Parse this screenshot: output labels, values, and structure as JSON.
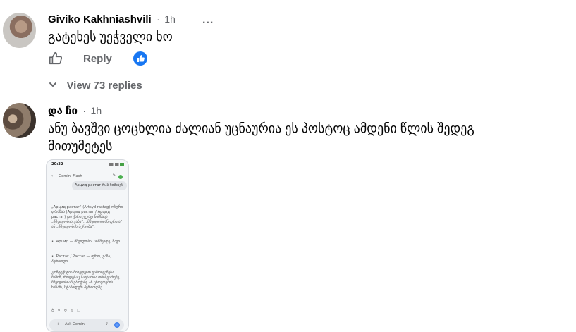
{
  "comment1": {
    "author": "Giviko Kakhniashvili",
    "separator": "·",
    "time": "1h",
    "more": "...",
    "text": "გატეხეს უეჭველი ხო",
    "reply_label": "Reply",
    "like_icon": "thumbs-up-outline-icon",
    "reaction_icon": "like-reaction-icon",
    "view_replies": "View 73 replies",
    "reaction_color": "#1877f2"
  },
  "comment2": {
    "author": "და ჩი",
    "separator": "·",
    "time": "1h",
    "text_line1": "ანუ ბავშვი ცოცხლია ძალიან უცნაურია ეს პოსტოც ამდენი წლის შედეგ",
    "text_line2": "მითუმეტეს"
  },
  "screenshot": {
    "status_time": "20:32",
    "app_title": "Gemini Flash",
    "user_bubble": "Арцид растаг რას ნიშნავს",
    "para1": "„Арцид растаг“ (Artsyd rastag) ოსური ფრაზაა (Арцыд растаг / Арцид растаг) და ქართულად ნიშნავს „მშვიდობის გაზა“, „მშვიდობიან ფრთა“ ან „მშვიდობის ჰერობა“.",
    "bullet1": "Арцид — მშვიდობა, სიმშვიდე, ზავი.",
    "bullet2": "Растаг / Растаг — ფრთ, გაზა, პერიოდი.",
    "para2": "კონტექსტის მიხედვით გამოიყენება მაშინ, როდესაც საუბარია ომისგარეშე, მშვიდობიან ეპოქაზე ან ცხოვრების ნაწარ, სტაბილურ პერიოდზე.",
    "input_placeholder": "Ask Gemini"
  }
}
